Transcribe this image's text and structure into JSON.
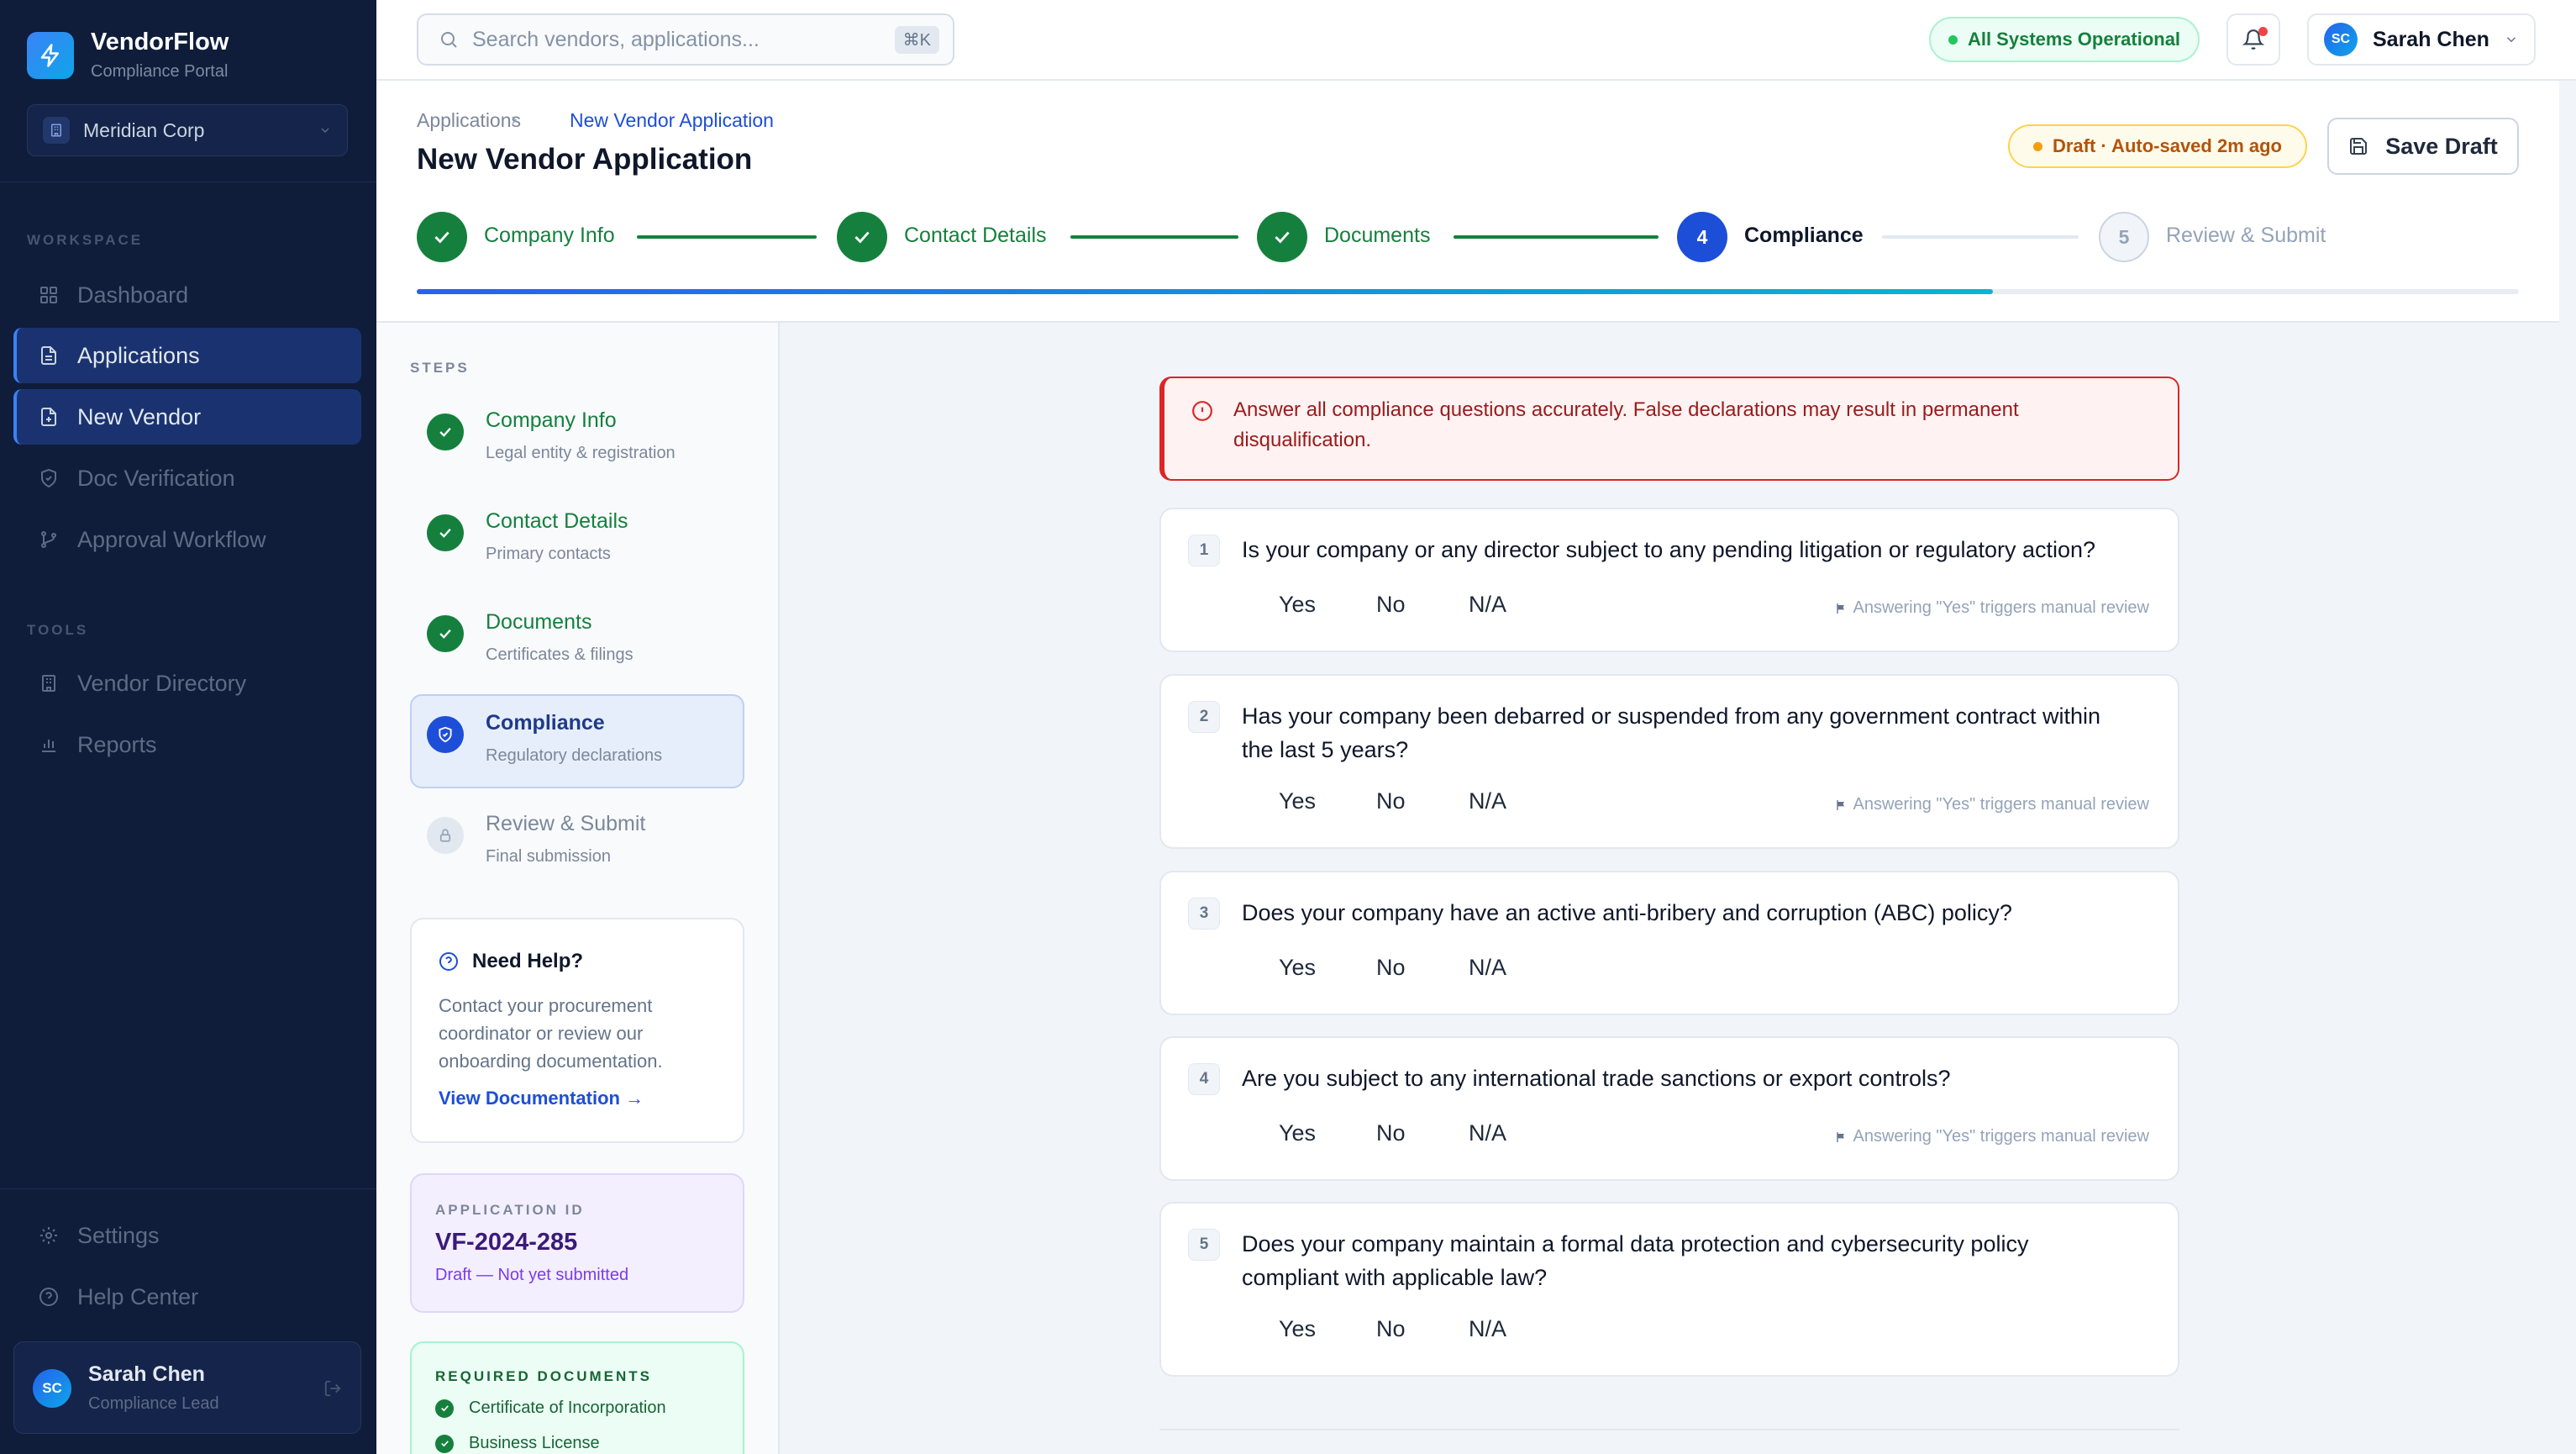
{
  "app": {
    "name": "VendorFlow",
    "subtitle": "Compliance Portal",
    "org": "Meridian Corp"
  },
  "sidebar": {
    "workspace_label": "WORKSPACE",
    "tools_label": "TOOLS",
    "workspace_items": [
      {
        "label": "Dashboard",
        "icon": "grid-icon"
      },
      {
        "label": "Applications",
        "icon": "file-text-icon"
      },
      {
        "label": "New Vendor",
        "icon": "file-plus-icon"
      },
      {
        "label": "Doc Verification",
        "icon": "shield-check-icon"
      },
      {
        "label": "Approval Workflow",
        "icon": "git-branch-icon"
      }
    ],
    "tool_items": [
      {
        "label": "Vendor Directory",
        "icon": "building-icon"
      },
      {
        "label": "Reports",
        "icon": "bar-chart-icon"
      }
    ],
    "footer_items": [
      {
        "label": "Settings",
        "icon": "gear-icon"
      },
      {
        "label": "Help Center",
        "icon": "help-circle-icon"
      }
    ],
    "user": {
      "initials": "SC",
      "name": "Sarah Chen",
      "role": "Compliance Lead"
    }
  },
  "topbar": {
    "search_placeholder": "Search vendors, applications...",
    "search_shortcut": "⌘K",
    "status": "All Systems Operational",
    "user_initials": "SC",
    "user_name": "Sarah Chen"
  },
  "page": {
    "breadcrumb": [
      "Applications",
      "New Vendor Application"
    ],
    "title": "New Vendor Application",
    "draft_status": "Draft · Auto-saved 2m ago",
    "save_label": "Save Draft",
    "progress_percent": 75
  },
  "stepper": [
    {
      "label": "Company Info",
      "state": "done"
    },
    {
      "label": "Contact Details",
      "state": "done"
    },
    {
      "label": "Documents",
      "state": "done"
    },
    {
      "label": "Compliance",
      "state": "active",
      "number": "4"
    },
    {
      "label": "Review & Submit",
      "state": "pending",
      "number": "5"
    }
  ],
  "steps_panel": {
    "heading": "STEPS",
    "items": [
      {
        "title": "Company Info",
        "sub": "Legal entity & registration",
        "state": "done"
      },
      {
        "title": "Contact Details",
        "sub": "Primary contacts",
        "state": "done"
      },
      {
        "title": "Documents",
        "sub": "Certificates & filings",
        "state": "done"
      },
      {
        "title": "Compliance",
        "sub": "Regulatory declarations",
        "state": "active"
      },
      {
        "title": "Review & Submit",
        "sub": "Final submission",
        "state": "locked"
      }
    ]
  },
  "help": {
    "title": "Need Help?",
    "body_lines": [
      "Contact your procurement",
      "coordinator or review our",
      "onboarding documentation."
    ],
    "link": "View Documentation →"
  },
  "application": {
    "label": "APPLICATION ID",
    "id": "VF-2024-285",
    "status": "Draft — Not yet submitted"
  },
  "required_docs": {
    "label": "REQUIRED DOCUMENTS",
    "items": [
      "Certificate of Incorporation",
      "Business License"
    ]
  },
  "alert": {
    "lines": [
      "Answer all compliance questions accurately. False declarations may result in permanent",
      "disqualification."
    ]
  },
  "questions": [
    {
      "n": "1",
      "lines": [
        "Is your company or any director subject to any pending litigation or regulatory action?"
      ],
      "note": "Answering \"Yes\" triggers manual review"
    },
    {
      "n": "2",
      "lines": [
        "Has your company been debarred or suspended from any government contract within",
        "the last 5 years?"
      ],
      "note": "Answering \"Yes\" triggers manual review"
    },
    {
      "n": "3",
      "lines": [
        "Does your company have an active anti-bribery and corruption (ABC) policy?"
      ],
      "note": ""
    },
    {
      "n": "4",
      "lines": [
        "Are you subject to any international trade sanctions or export controls?"
      ],
      "note": "Answering \"Yes\" triggers manual review"
    },
    {
      "n": "5",
      "lines": [
        "Does your company maintain a formal data protection and cybersecurity policy",
        "compliant with applicable law?"
      ],
      "note": ""
    }
  ],
  "options": [
    "Yes",
    "No",
    "N/A"
  ],
  "colors": {
    "sidebar_bg": "#0f1d3a",
    "accent": "#2563eb",
    "success": "#15803d",
    "danger": "#dc2626",
    "warning": "#b45309"
  }
}
